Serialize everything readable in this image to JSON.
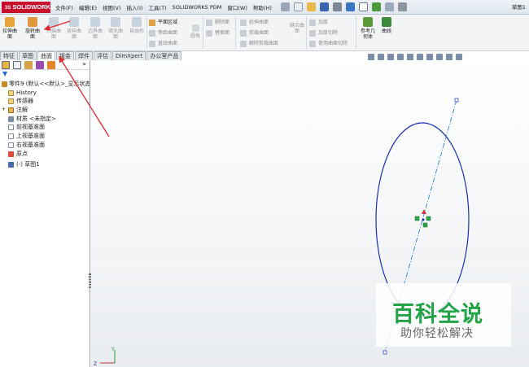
{
  "titlebar": {
    "logo": "SOLIDWORKS",
    "menus": [
      "文件(F)",
      "编辑(E)",
      "视图(V)",
      "插入(I)",
      "工具(T)",
      "SOLIDWORKS PDM",
      "窗口(W)",
      "帮助(H)"
    ],
    "window_title": "草图1"
  },
  "ribbon": {
    "extrude_surface": "拉伸曲面",
    "revolve_surface": "旋转曲面",
    "sweep_surface": "扫描曲面",
    "loft_surface": "放样曲面",
    "boundary_surface": "边界曲面",
    "filled_surface": "填充曲面",
    "freeform": "自由形",
    "planar_surface": "平面区域",
    "offset_surface": "等距曲面",
    "ruled_surface": "直纹曲面",
    "fillet": "圆角",
    "delete_face": "删除面",
    "replace_face": "替换面",
    "extend_surface": "延伸曲面",
    "trim_surface": "剪裁曲面",
    "untrim_surface": "解除剪裁曲面",
    "knit_surface": "缝合曲面",
    "thicken": "加厚",
    "thickened_cut": "加厚切除",
    "cut_with_surface": "使用曲面切除",
    "reference_geometry": "参考几何体",
    "curves": "曲线"
  },
  "tabs": [
    {
      "label": "特征",
      "active": false
    },
    {
      "label": "草图",
      "active": false
    },
    {
      "label": "曲面",
      "active": true
    },
    {
      "label": "钣金",
      "active": false
    },
    {
      "label": "焊件",
      "active": false
    },
    {
      "label": "评估",
      "active": false
    },
    {
      "label": "DimXpert",
      "active": false
    },
    {
      "label": "办公室产品",
      "active": false
    }
  ],
  "tree": {
    "root": "零件9 (默认<<默认>_显示状态",
    "items": [
      "History",
      "传感器",
      "注解",
      "材质 <未指定>",
      "前视基准面",
      "上视基准面",
      "右视基准面",
      "原点",
      "(-) 草图1"
    ]
  },
  "watermark": {
    "title": "百科全说",
    "subtitle": "助你轻松解决"
  },
  "colors": {
    "brand_red": "#c8102e",
    "sketch_ellipse": "#1a2fb4",
    "centerline": "#2a7fd4",
    "annotation_arrow": "#e0282e",
    "watermark_green": "#1fa345"
  }
}
